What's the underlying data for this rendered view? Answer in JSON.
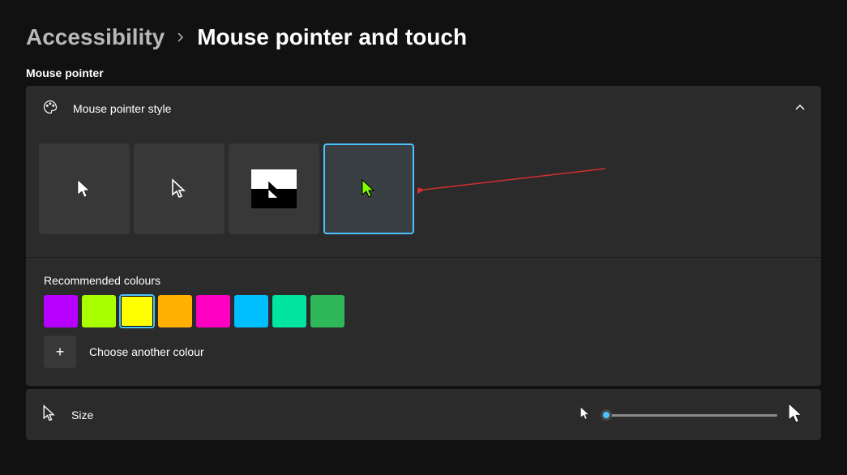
{
  "breadcrumb": {
    "parent": "Accessibility",
    "current": "Mouse pointer and touch"
  },
  "section": {
    "label": "Mouse pointer"
  },
  "style_card": {
    "title": "Mouse pointer style",
    "selected_index": 3,
    "custom_cursor_color": "#7fff00",
    "recommended_label": "Recommended colours",
    "colours": [
      "#b700ff",
      "#a9ff00",
      "#ffff00",
      "#ffb000",
      "#ff00c3",
      "#00bfff",
      "#00e6a0",
      "#2fb85a"
    ],
    "selected_colour_index": 2,
    "choose_label": "Choose another colour"
  },
  "size_card": {
    "title": "Size"
  },
  "annotation": {
    "arrow_color": "#d32f2f"
  }
}
